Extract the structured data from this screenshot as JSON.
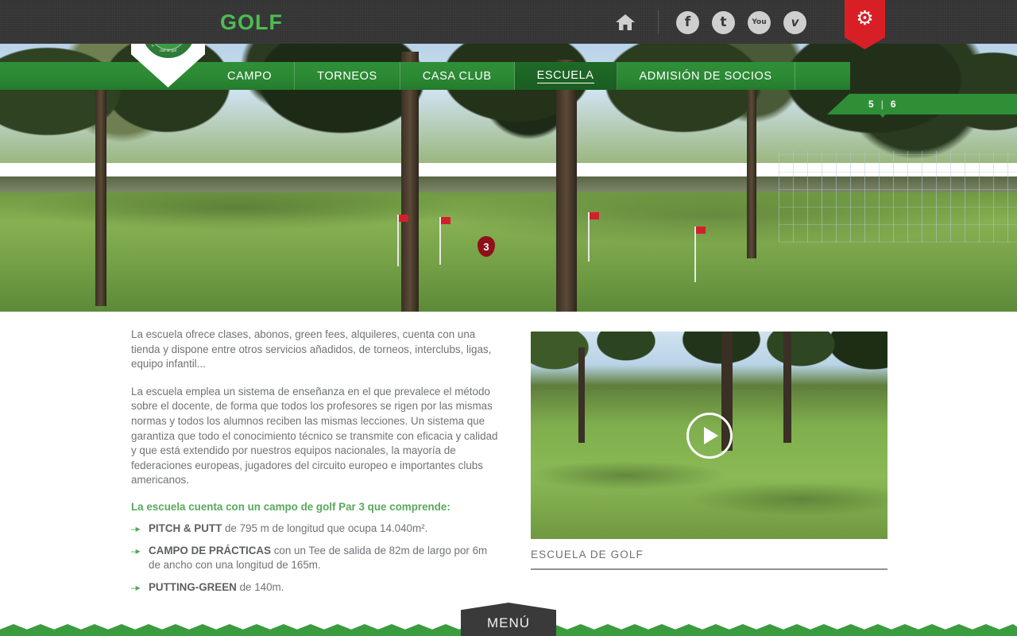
{
  "header": {
    "brand_word": "GOLF",
    "logo": {
      "ring_text": "LOS ANGELES DE SAN RAFAEL",
      "subtitle": "club de golf"
    },
    "icons": [
      {
        "name": "home-icon",
        "glyph": "⌂"
      },
      {
        "name": "facebook-icon",
        "glyph": "f"
      },
      {
        "name": "twitter-icon",
        "glyph": "t"
      },
      {
        "name": "youtube-icon",
        "glyph": "You"
      },
      {
        "name": "vimeo-icon",
        "glyph": "v"
      }
    ],
    "settings_button": {
      "name": "gear-icon",
      "glyph": "⚙"
    },
    "accent_red": "#d81f26",
    "accent_green": "#4dbd52",
    "bar_color": "#343434"
  },
  "nav": {
    "items": [
      {
        "label": "CAMPO",
        "active": false
      },
      {
        "label": "TORNEOS",
        "active": false
      },
      {
        "label": "CASA CLUB",
        "active": false
      },
      {
        "label": "ESCUELA",
        "active": true
      },
      {
        "label": "ADMISIÓN DE SOCIOS",
        "active": false
      }
    ],
    "bar_color": "#2c8a34"
  },
  "hero": {
    "hole_marker": "3",
    "slider": {
      "current": "5",
      "separator": "|",
      "total": "6"
    }
  },
  "main": {
    "paragraphs": [
      "La escuela ofrece clases, abonos, green fees, alquileres, cuenta con una tienda y dispone entre otros servicios añadidos, de torneos, interclubs, ligas, equipo infantil...",
      "La escuela emplea un sistema de enseñanza en el que prevalece el método sobre el docente, de forma que todos los profesores se rigen por las mismas normas y todos los alumnos reciben las mismas lecciones. Un sistema que garantiza que todo el conocimiento técnico se transmite con eficacia y calidad y que está extendido por nuestros equipos nacionales, la mayoría de federaciones europeas, jugadores del circuito europeo e importantes clubs americanos."
    ],
    "list_heading": "La escuela cuenta con un campo de golf Par 3 que comprende:",
    "list_items": [
      {
        "term": "PITCH & PUTT",
        "rest": " de 795 m de longitud que ocupa 14.040m²."
      },
      {
        "term": "CAMPO DE PRÁCTICAS",
        "rest": " con un Tee de salida de 82m de largo por 6m de ancho con una longitud de 165m."
      },
      {
        "term": "PUTTING-GREEN",
        "rest": " de 140m."
      }
    ],
    "list_marker": "–▸",
    "heading_color": "#58a95c"
  },
  "video": {
    "caption": "ESCUELA DE GOLF",
    "play_label": "play"
  },
  "footer": {
    "menu_label": "MENÚ",
    "zigzag_color": "#3a9b3f"
  }
}
